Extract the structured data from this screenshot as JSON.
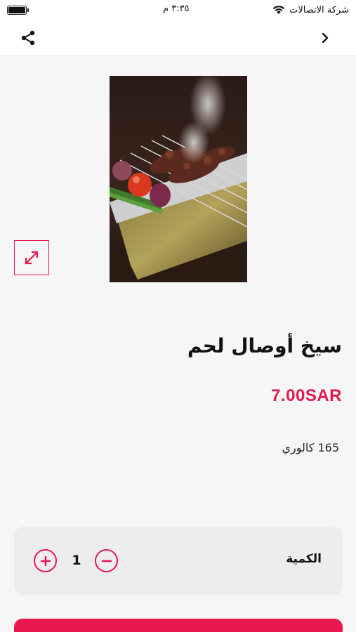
{
  "status_bar": {
    "carrier": "شركة الاتصالات",
    "time": "٣:٣٥ م",
    "battery_level": 1.0
  },
  "nav": {
    "share_icon": "share-icon",
    "back_icon": "chevron-right-icon"
  },
  "product": {
    "name": "سيخ أوصال لحم",
    "price": "7.00SAR",
    "calories": "165 كالوري",
    "image_icon": "expand-icon"
  },
  "quantity": {
    "label": "الكمية",
    "value": "1",
    "plus_icon": "plus-circle-icon",
    "minus_icon": "minus-circle-icon"
  },
  "colors": {
    "accent": "#e8174d",
    "background": "#f6f6f6",
    "card": "#ededf0"
  }
}
